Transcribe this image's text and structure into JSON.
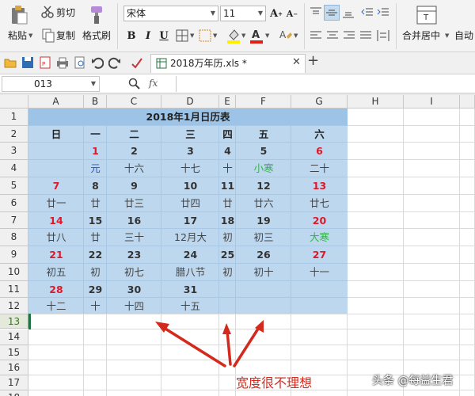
{
  "ribbon": {
    "cut": "剪切",
    "paste": "粘贴",
    "copy": "复制",
    "format_painter": "格式刷",
    "font_name": "宋体",
    "font_size": "11",
    "bold": "B",
    "italic": "I",
    "underline": "U",
    "grow_font": "A",
    "shrink_font": "A",
    "merge_center": "合并居中",
    "auto_wrap": "自动"
  },
  "tab": {
    "title": "2018万年历.xls *"
  },
  "formula_bar": {
    "name_box": "013",
    "fx": "fx"
  },
  "columns": [
    "A",
    "B",
    "C",
    "D",
    "E",
    "F",
    "G",
    "H",
    "I"
  ],
  "rows": [
    "1",
    "2",
    "3",
    "4",
    "5",
    "6",
    "7",
    "8",
    "9",
    "10",
    "11",
    "12",
    "13",
    "14",
    "15",
    "16",
    "17",
    "18"
  ],
  "calendar": {
    "title": "2018年1月日历表",
    "weekdays": [
      "日",
      "一",
      "二",
      "三",
      "四",
      "五",
      "六"
    ],
    "weeks": [
      {
        "days": [
          "",
          "1",
          "2",
          "3",
          "4",
          "5",
          "6"
        ],
        "lunar": [
          "",
          "元",
          "十六",
          "十七",
          "十",
          "小寒",
          "二十"
        ]
      },
      {
        "days": [
          "7",
          "8",
          "9",
          "10",
          "11",
          "12",
          "13"
        ],
        "lunar": [
          "廿一",
          "廿",
          "廿三",
          "廿四",
          "廿",
          "廿六",
          "廿七"
        ]
      },
      {
        "days": [
          "14",
          "15",
          "16",
          "17",
          "18",
          "19",
          "20"
        ],
        "lunar": [
          "廿八",
          "廿",
          "三十",
          "12月大",
          "初",
          "初三",
          "大寒"
        ]
      },
      {
        "days": [
          "21",
          "22",
          "23",
          "24",
          "25",
          "26",
          "27"
        ],
        "lunar": [
          "初五",
          "初",
          "初七",
          "腊八节",
          "初",
          "初十",
          "十一"
        ]
      },
      {
        "days": [
          "28",
          "29",
          "30",
          "31",
          "",
          "",
          ""
        ],
        "lunar": [
          "十二",
          "十",
          "十四",
          "十五",
          "",
          "",
          ""
        ]
      }
    ]
  },
  "annotation": "宽度很不理想",
  "watermark": "头条 @每益生君",
  "colors": {
    "accent_green": "#217346",
    "calendar_fill": "#bdd7ee",
    "calendar_header": "#9dc3e6",
    "arrow_red": "#d42a1e"
  }
}
